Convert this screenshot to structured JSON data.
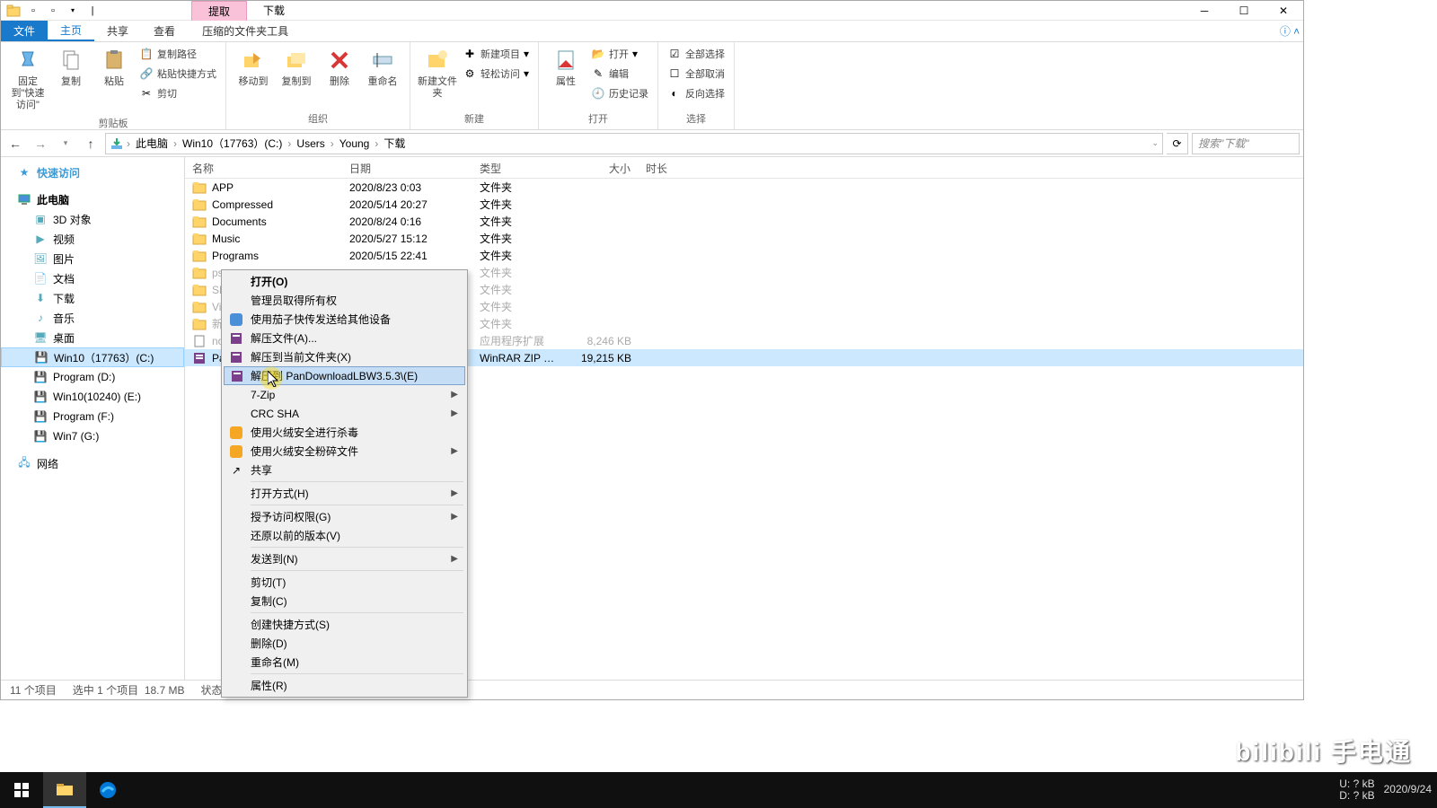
{
  "titlebar": {
    "context_tab_extract": "提取",
    "context_tab_download": "下载"
  },
  "tabs": {
    "file": "文件",
    "home": "主页",
    "share": "共享",
    "view": "查看",
    "compressed": "压缩的文件夹工具"
  },
  "ribbon": {
    "pin": "固定到\"快速访问\"",
    "copy": "复制",
    "paste": "粘贴",
    "copypath": "复制路径",
    "pasteshortcut": "粘贴快捷方式",
    "cut": "剪切",
    "clipboard_label": "剪贴板",
    "moveto": "移动到",
    "copyto": "复制到",
    "delete": "删除",
    "rename": "重命名",
    "organize_label": "组织",
    "newfolder": "新建文件夹",
    "newitem": "新建项目",
    "easyaccess": "轻松访问",
    "new_label": "新建",
    "properties": "属性",
    "open": "打开",
    "edit": "编辑",
    "history": "历史记录",
    "open_label": "打开",
    "selectall": "全部选择",
    "selectnone": "全部取消",
    "invertsel": "反向选择",
    "select_label": "选择"
  },
  "breadcrumb": {
    "thispc": "此电脑",
    "drive": "Win10（17763）(C:)",
    "users": "Users",
    "user": "Young",
    "downloads": "下载"
  },
  "search_placeholder": "搜索\"下载\"",
  "nav": {
    "quickaccess": "快速访问",
    "thispc": "此电脑",
    "objects3d": "3D 对象",
    "videos": "视频",
    "pictures": "图片",
    "documents": "文档",
    "downloads": "下载",
    "music": "音乐",
    "desktop": "桌面",
    "drive_c": "Win10（17763）(C:)",
    "drive_d": "Program (D:)",
    "drive_e": "Win10(10240) (E:)",
    "drive_f": "Program (F:)",
    "drive_g": "Win7 (G:)",
    "network": "网络"
  },
  "columns": {
    "name": "名称",
    "date": "日期",
    "type": "类型",
    "size": "大小",
    "duration": "时长"
  },
  "files": [
    {
      "name": "APP",
      "date": "2020/8/23 0:03",
      "type": "文件夹",
      "size": "",
      "icon": "folder"
    },
    {
      "name": "Compressed",
      "date": "2020/5/14 20:27",
      "type": "文件夹",
      "size": "",
      "icon": "folder"
    },
    {
      "name": "Documents",
      "date": "2020/8/24 0:16",
      "type": "文件夹",
      "size": "",
      "icon": "folder"
    },
    {
      "name": "Music",
      "date": "2020/5/27 15:12",
      "type": "文件夹",
      "size": "",
      "icon": "folder"
    },
    {
      "name": "Programs",
      "date": "2020/5/15 22:41",
      "type": "文件夹",
      "size": "",
      "icon": "folder"
    },
    {
      "name": "ps",
      "date": "",
      "type": "文件夹",
      "size": "",
      "icon": "folder",
      "dim": true
    },
    {
      "name": "SH",
      "date": "",
      "type": "文件夹",
      "size": "",
      "icon": "folder",
      "dim": true
    },
    {
      "name": "Vi",
      "date": "",
      "type": "文件夹",
      "size": "",
      "icon": "folder",
      "dim": true
    },
    {
      "name": "新",
      "date": "",
      "type": "文件夹",
      "size": "",
      "icon": "folder",
      "dim": true
    },
    {
      "name": "no",
      "date": "",
      "type": "应用程序扩展",
      "size": "8,246 KB",
      "icon": "file",
      "dim": true
    },
    {
      "name": "Pa",
      "date": "",
      "type": "WinRAR ZIP 压缩...",
      "size": "19,215 KB",
      "icon": "rar",
      "selected": true
    }
  ],
  "context_menu": [
    {
      "label": "打开(O)",
      "bold": true
    },
    {
      "label": "管理员取得所有权"
    },
    {
      "label": "使用茄子快传发送给其他设备",
      "icon": "#4a90d9"
    },
    {
      "label": "解压文件(A)...",
      "icon": "rar"
    },
    {
      "label": "解压到当前文件夹(X)",
      "icon": "rar"
    },
    {
      "label": "解压到 PanDownloadLBW3.5.3\\(E)",
      "icon": "rar",
      "hovered": true
    },
    {
      "label": "7-Zip",
      "submenu": true
    },
    {
      "label": "CRC SHA",
      "submenu": true
    },
    {
      "label": "使用火绒安全进行杀毒",
      "icon": "#f5a623"
    },
    {
      "label": "使用火绒安全粉碎文件",
      "icon": "#f5a623",
      "submenu": true
    },
    {
      "label": "共享",
      "icon": "share"
    },
    {
      "sep": true
    },
    {
      "label": "打开方式(H)",
      "submenu": true
    },
    {
      "sep": true
    },
    {
      "label": "授予访问权限(G)",
      "submenu": true
    },
    {
      "label": "还原以前的版本(V)"
    },
    {
      "sep": true
    },
    {
      "label": "发送到(N)",
      "submenu": true
    },
    {
      "sep": true
    },
    {
      "label": "剪切(T)"
    },
    {
      "label": "复制(C)"
    },
    {
      "sep": true
    },
    {
      "label": "创建快捷方式(S)"
    },
    {
      "label": "删除(D)"
    },
    {
      "label": "重命名(M)"
    },
    {
      "sep": true
    },
    {
      "label": "属性(R)"
    }
  ],
  "statusbar": {
    "items": "11 个项目",
    "selected": "选中 1 个项目",
    "size": "18.7 MB",
    "state": "状态:"
  },
  "tray": {
    "u_label": "U:",
    "d_label": "D:",
    "u_val": "? kB",
    "d_val": "? kB",
    "time": "",
    "date": "2020/9/24"
  },
  "watermark": "bilibili 手电通"
}
